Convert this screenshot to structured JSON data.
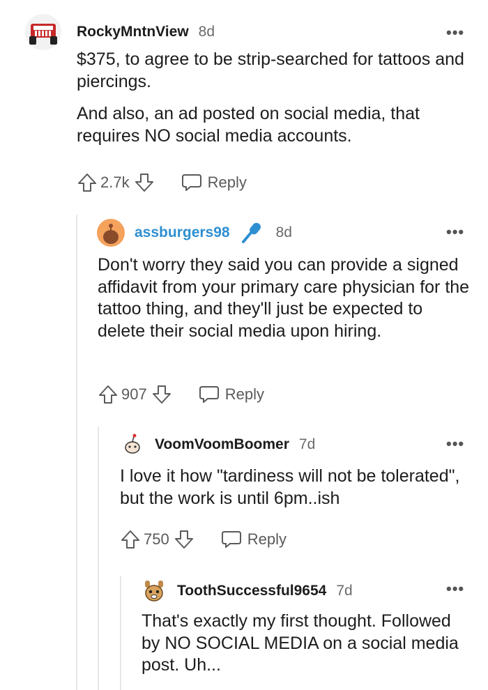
{
  "comments": [
    {
      "username": "RockyMntnView",
      "age": "8d",
      "paragraphs": [
        "$375, to agree to be strip-searched for tattoos and piercings.",
        "And also, an ad posted on social media, that requires NO social media accounts."
      ],
      "score": "2.7k",
      "reply_label": "Reply",
      "more_label": "•••"
    },
    {
      "username": "assburgers98",
      "username_color": "#2e8fd1",
      "age": "8d",
      "paragraphs": [
        "Don't worry they said you can provide a signed affidavit from your primary care physician for the tattoo thing, and they'll just be expected to delete their social media upon hiring."
      ],
      "score": "907",
      "reply_label": "Reply",
      "more_label": "•••"
    },
    {
      "username": "VoomVoomBoomer",
      "age": "7d",
      "paragraphs": [
        "I love it how \"tardiness will not be tolerated\", but the work is until 6pm..ish"
      ],
      "score": "750",
      "reply_label": "Reply",
      "more_label": "•••"
    },
    {
      "username": "ToothSuccessful9654",
      "age": "7d",
      "paragraphs": [
        "That's exactly my first thought. Followed by NO SOCIAL MEDIA on a social media post. Uh..."
      ],
      "more_label": "•••"
    }
  ],
  "icons": {
    "upvote": "upvote-arrow-icon",
    "downvote": "downvote-arrow-icon",
    "reply": "speech-bubble-icon",
    "mic": "microphone-icon"
  }
}
